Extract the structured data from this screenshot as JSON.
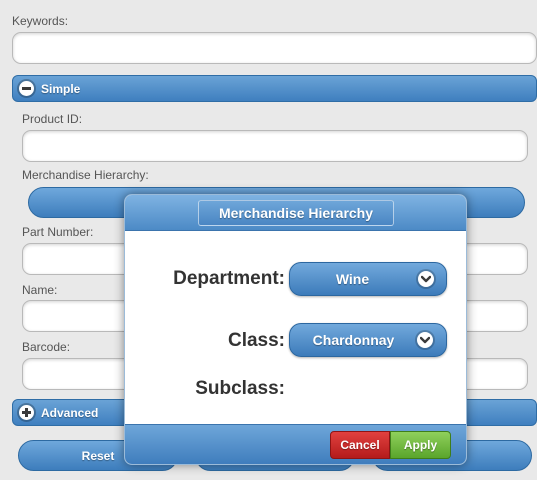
{
  "form": {
    "keywords_label": "Keywords:",
    "keywords_value": "",
    "simple_section_label": "Simple",
    "product_id_label": "Product ID:",
    "product_id_value": "",
    "merch_hierarchy_label": "Merchandise Hierarchy:",
    "part_number_label": "Part Number:",
    "part_number_value": "",
    "name_label": "Name:",
    "name_value": "",
    "barcode_label": "Barcode:",
    "barcode_value": "",
    "advanced_section_label": "Advanced",
    "reset_label": "Reset"
  },
  "dialog": {
    "title": "Merchandise Hierarchy",
    "department_label": "Department:",
    "department_value": "Wine",
    "class_label": "Class:",
    "class_value": "Chardonnay",
    "subclass_label": "Subclass:",
    "cancel_label": "Cancel",
    "apply_label": "Apply"
  },
  "colors": {
    "accent_blue": "#4a86c3",
    "cancel_red": "#c62828",
    "apply_green": "#6cb33f"
  }
}
